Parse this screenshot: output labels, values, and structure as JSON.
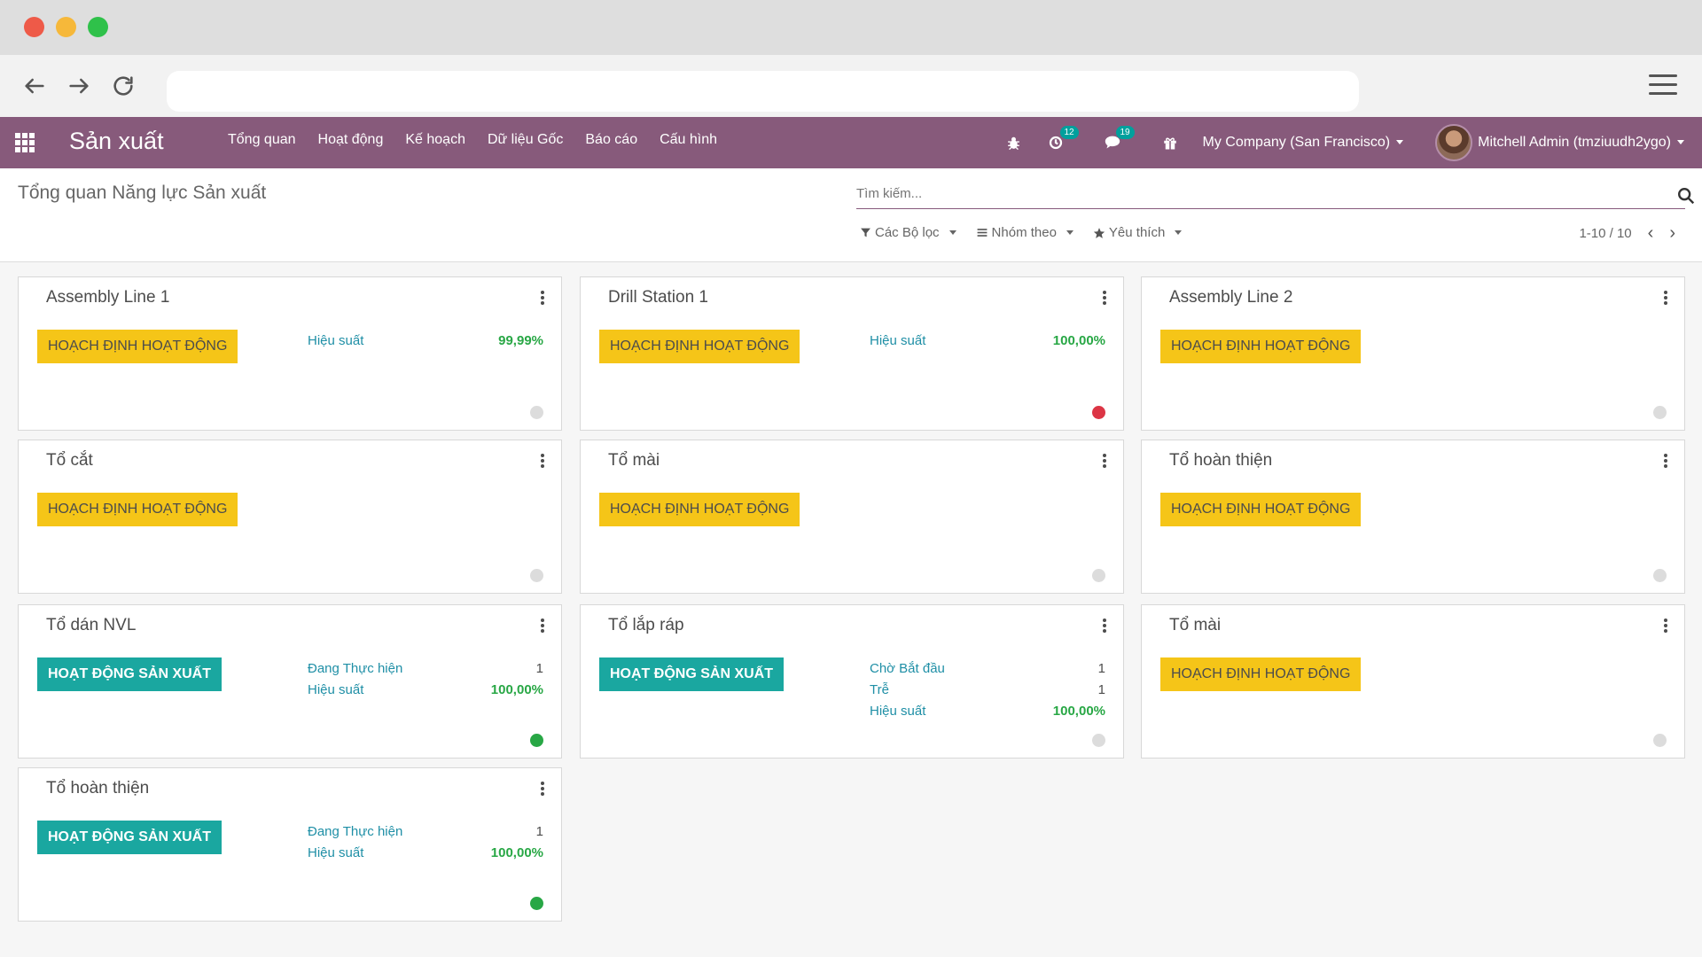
{
  "topbar": {
    "app_name": "Sản xuất",
    "menu": [
      "Tổng quan",
      "Hoạt động",
      "Kế hoạch",
      "Dữ liệu Gốc",
      "Báo cáo",
      "Cấu hình"
    ],
    "activity_count": "12",
    "message_count": "19",
    "company": "My Company (San Francisco)",
    "user": "Mitchell Admin (tmziuudh2ygo)"
  },
  "control": {
    "title": "Tổng quan Năng lực Sản xuất",
    "search_placeholder": "Tìm kiếm...",
    "filters_label": "Các Bộ lọc",
    "group_label": "Nhóm theo",
    "favorites_label": "Yêu thích",
    "pager": "1-10 / 10"
  },
  "colors": {
    "brand": "#875a7b",
    "planning": "#f5c518",
    "producing": "#1aa7a0",
    "status_grey": "#dcdcdc",
    "status_red": "#dc3545",
    "status_green": "#28a745"
  },
  "cards": [
    {
      "title": "Assembly Line 1",
      "state": "HOẠCH ĐỊNH HOẠT ĐỘNG",
      "kind": "plan",
      "status": "grey",
      "stats": [
        {
          "label": "Hiệu suất",
          "value": "99,99%",
          "ok": true
        }
      ]
    },
    {
      "title": "Drill Station 1",
      "state": "HOẠCH ĐỊNH HOẠT ĐỘNG",
      "kind": "plan",
      "status": "red",
      "stats": [
        {
          "label": "Hiệu suất",
          "value": "100,00%",
          "ok": true
        }
      ]
    },
    {
      "title": "Assembly Line 2",
      "state": "HOẠCH ĐỊNH HOẠT ĐỘNG",
      "kind": "plan",
      "status": "grey",
      "stats": []
    },
    {
      "title": "Tổ cắt",
      "state": "HOẠCH ĐỊNH HOẠT ĐỘNG",
      "kind": "plan",
      "status": "grey",
      "stats": []
    },
    {
      "title": "Tổ mài",
      "state": "HOẠCH ĐỊNH HOẠT ĐỘNG",
      "kind": "plan",
      "status": "grey",
      "stats": []
    },
    {
      "title": "Tổ hoàn thiện",
      "state": "HOẠCH ĐỊNH HOẠT ĐỘNG",
      "kind": "plan",
      "status": "grey",
      "stats": []
    },
    {
      "title": "Tổ dán NVL",
      "state": "HOẠT ĐỘNG SẢN XUẤT",
      "kind": "prod",
      "status": "green",
      "stats": [
        {
          "label": "Đang Thực hiện",
          "value": "1",
          "ok": false
        },
        {
          "label": "Hiệu suất",
          "value": "100,00%",
          "ok": true
        }
      ]
    },
    {
      "title": "Tổ lắp ráp",
      "state": "HOẠT ĐỘNG SẢN XUẤT",
      "kind": "prod",
      "status": "grey",
      "stats": [
        {
          "label": "Chờ Bắt đầu",
          "value": "1",
          "ok": false
        },
        {
          "label": "Trễ",
          "value": "1",
          "ok": false
        },
        {
          "label": "Hiệu suất",
          "value": "100,00%",
          "ok": true
        }
      ]
    },
    {
      "title": "Tổ mài",
      "state": "HOẠCH ĐỊNH HOẠT ĐỘNG",
      "kind": "plan",
      "status": "grey",
      "stats": []
    },
    {
      "title": "Tổ hoàn thiện",
      "state": "HOẠT ĐỘNG SẢN XUẤT",
      "kind": "prod",
      "status": "green",
      "stats": [
        {
          "label": "Đang Thực hiện",
          "value": "1",
          "ok": false
        },
        {
          "label": "Hiệu suất",
          "value": "100,00%",
          "ok": true
        }
      ]
    }
  ]
}
